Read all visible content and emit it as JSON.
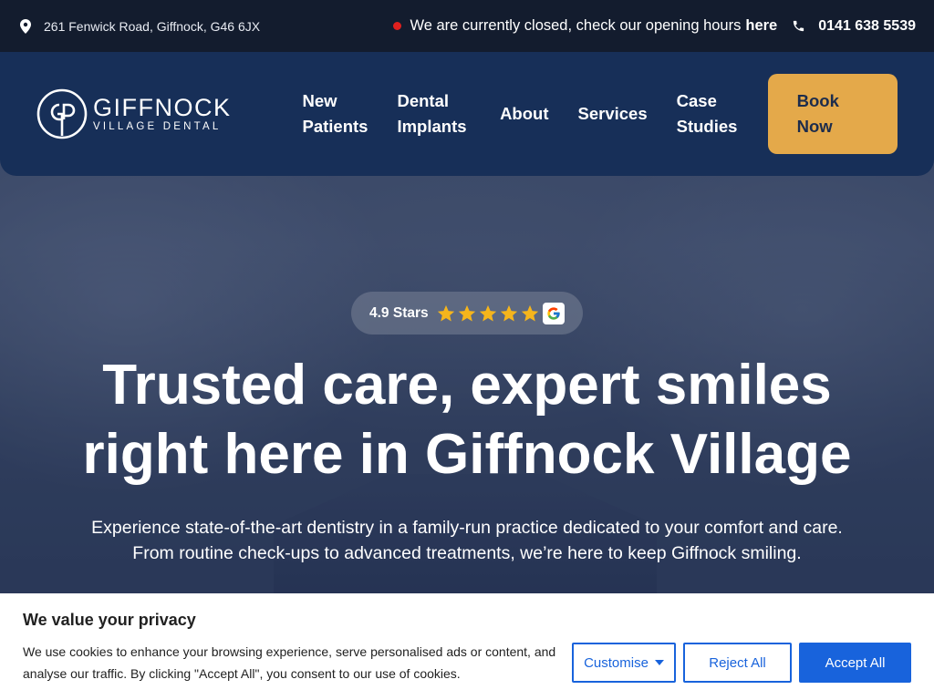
{
  "topbar": {
    "address": "261 Fenwick Road, Giffnock, G46 6JX",
    "status_text": "We are currently closed, check our opening hours",
    "status_link": "here",
    "phone": "0141 638 5539"
  },
  "header": {
    "logo_brand": "GIFFNOCK",
    "logo_sub": "VILLAGE DENTAL",
    "nav": [
      {
        "label": "New Patients"
      },
      {
        "label": "Dental Implants"
      },
      {
        "label": "About"
      },
      {
        "label": "Services"
      },
      {
        "label": "Case Studies"
      }
    ],
    "cta_label": "Book Now"
  },
  "hero": {
    "rating_label": "4.9 Stars",
    "rating_stars": 5,
    "title_line1": "Trusted care, expert smiles",
    "title_line2": "right here in Giffnock Village",
    "subtitle": "Experience state-of-the-art dentistry in a family-run practice dedicated to your comfort and care. From routine check-ups to advanced treatments, we’re here to keep Giffnock smiling."
  },
  "cookie": {
    "title": "We value your privacy",
    "body": "We use cookies to enhance your browsing experience, serve personalised ads or content, and analyse our traffic. By clicking \"Accept All\", you consent to our use of cookies.",
    "customise_label": "Customise",
    "reject_label": "Reject All",
    "accept_label": "Accept All"
  },
  "colors": {
    "topbar_bg": "#131c2e",
    "header_bg": "#172f58",
    "cta_bg": "#e4a94a",
    "status_dot": "#e0201e",
    "cookie_accent": "#1863dc",
    "star": "#f5b51c"
  },
  "icons": {
    "address": "map-pin-icon",
    "phone": "phone-icon",
    "google": "google-g-icon",
    "star": "star-icon",
    "dropdown": "caret-down-icon"
  }
}
